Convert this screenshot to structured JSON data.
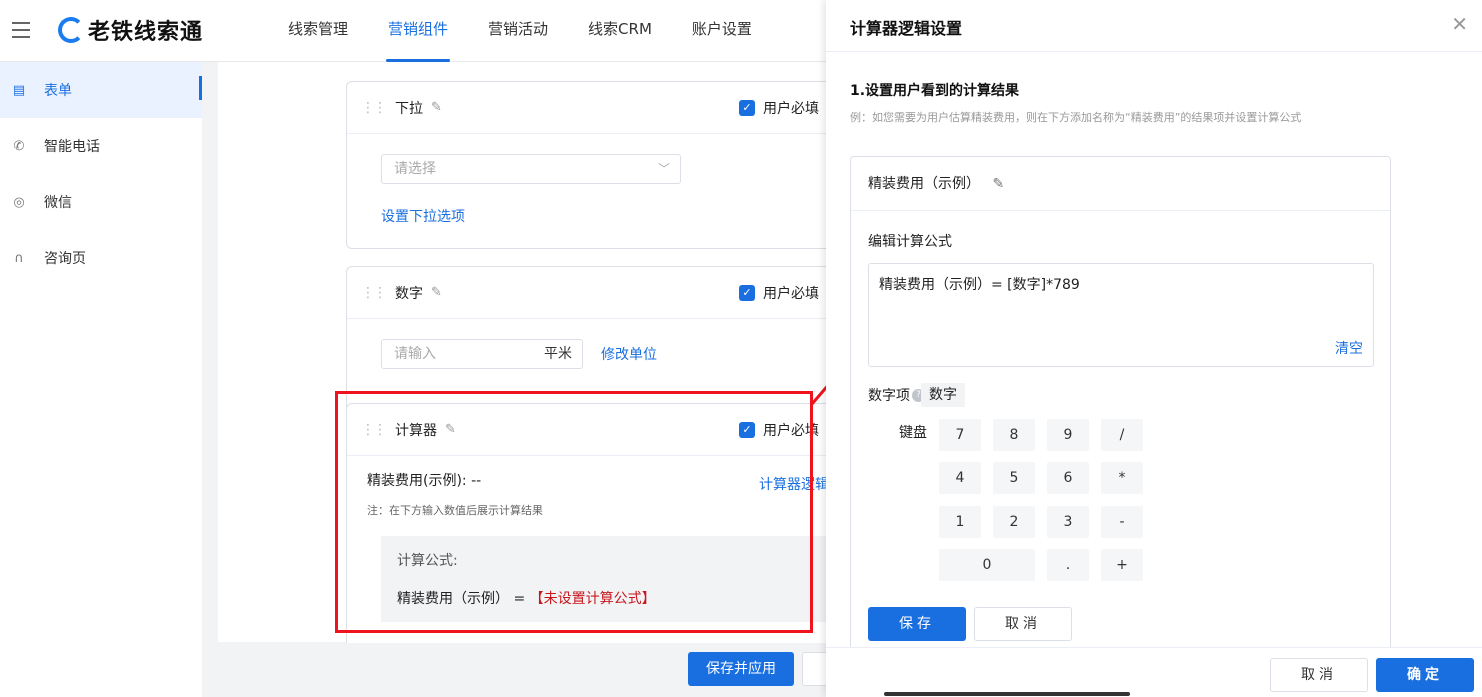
{
  "header": {
    "logo_text": "老铁线索通",
    "nav": [
      "线索管理",
      "营销组件",
      "营销活动",
      "线索CRM",
      "账户设置"
    ]
  },
  "sidebar": {
    "items": [
      {
        "label": "表单",
        "icon": "form-icon"
      },
      {
        "label": "智能电话",
        "icon": "phone-icon"
      },
      {
        "label": "微信",
        "icon": "wechat-icon"
      },
      {
        "label": "咨询页",
        "icon": "headset-icon"
      }
    ]
  },
  "form": {
    "dropdown": {
      "title": "下拉",
      "required_label": "用户必填",
      "placeholder": "请选择",
      "link": "设置下拉选项"
    },
    "number": {
      "title": "数字",
      "required_label": "用户必填",
      "placeholder": "请输入",
      "unit": "平米",
      "link": "修改单位"
    },
    "calculator": {
      "title": "计算器",
      "required_label": "用户必填",
      "result_line": "精装费用(示例): --",
      "logic_link": "计算器逻辑",
      "note": "注：在下方输入数值后展示计算结果",
      "formula_label": "计算公式:",
      "formula_name": "精装费用（示例）",
      "formula_eq": " = ",
      "formula_unset": "【未设置计算公式】"
    },
    "save_apply": "保存并应用"
  },
  "drawer": {
    "title": "计算器逻辑设置",
    "section_title": "1.设置用户看到的计算结果",
    "hint": "例：如您需要为用户估算精装费用，则在下方添加名称为“精装费用”的结果项并设置计算公式",
    "result_name": "精装费用（示例）",
    "edit_formula_label": "编辑计算公式",
    "formula_text": "精装费用（示例）= [数字]*789",
    "clear": "清空",
    "num_items_label": "数字项",
    "num_tag": "数字",
    "keyboard_label": "键盘",
    "keys": [
      "7",
      "8",
      "9",
      "/",
      "4",
      "5",
      "6",
      "*",
      "1",
      "2",
      "3",
      "-",
      "0",
      ".",
      "+"
    ],
    "save": "保存",
    "cancel": "取消",
    "footer_cancel": "取消",
    "footer_ok": "确定"
  },
  "colors": {
    "accent": "#1a6fe0",
    "highlight": "#f0131e",
    "unset_formula": "#c8161d"
  }
}
